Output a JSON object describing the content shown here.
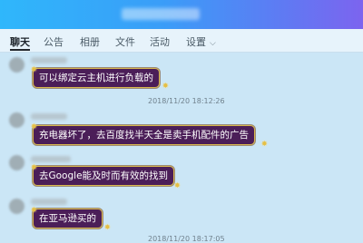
{
  "tabs": [
    {
      "label": "聊天",
      "active": true
    },
    {
      "label": "公告"
    },
    {
      "label": "相册"
    },
    {
      "label": "文件"
    },
    {
      "label": "活动"
    },
    {
      "label": "设置"
    }
  ],
  "icons": {
    "settings_dropdown": "chevron-down-icon",
    "chevron_glyph": "⌵"
  },
  "colors": {
    "bubble_bg": "#4b1e58",
    "bubble_border": "#d9b94f",
    "header_gradient_start": "#2fb7fb",
    "header_gradient_end": "#7c64ef"
  },
  "messages": [
    {
      "text": "可以绑定云主机进行负载的",
      "timestamp": "2018/11/20 18:12:26"
    },
    {
      "text": "充电器坏了，去百度找半天全是卖手机配件的广告",
      "timestamp": ""
    },
    {
      "text": "去Google能及时而有效的找到",
      "timestamp": ""
    },
    {
      "text": "在亚马逊买的",
      "timestamp": "2018/11/20 18:17:05"
    }
  ]
}
